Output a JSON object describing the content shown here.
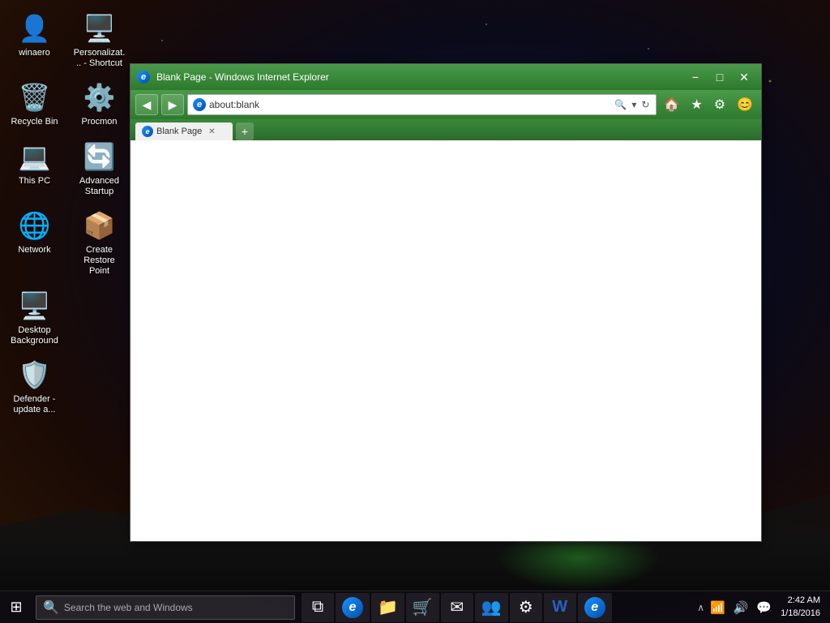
{
  "desktop": {
    "icons": [
      {
        "id": "winaero",
        "label": "winaero",
        "emoji": "👤",
        "color": "#f0c060"
      },
      {
        "id": "personalize-shortcut",
        "label": "Personalizat... - Shortcut",
        "emoji": "🖥️",
        "color": "#4488cc"
      },
      {
        "id": "recycle-bin",
        "label": "Recycle Bin",
        "emoji": "🗑️",
        "color": "#c0c0c0"
      },
      {
        "id": "procmon",
        "label": "Procmon",
        "emoji": "⚙️",
        "color": "#ff8800"
      },
      {
        "id": "this-pc",
        "label": "This PC",
        "emoji": "💻",
        "color": "#4488ee"
      },
      {
        "id": "advanced-startup",
        "label": "Advanced Startup",
        "emoji": "🔄",
        "color": "#00aaff"
      },
      {
        "id": "network",
        "label": "Network",
        "emoji": "🌐",
        "color": "#4488ee"
      },
      {
        "id": "create-restore-point",
        "label": "Create Restore Point",
        "emoji": "📦",
        "color": "#44bb44"
      },
      {
        "id": "desktop-background",
        "label": "Desktop Background",
        "emoji": "🖥️",
        "color": "#4488cc"
      },
      {
        "id": "defender-update",
        "label": "Defender - update a...",
        "emoji": "🛡️",
        "color": "#c0c0c0"
      }
    ]
  },
  "browser": {
    "title": "Blank Page - Windows Internet Explorer",
    "address": "about:blank",
    "tab_title": "Blank Page",
    "tab_icon": "ie",
    "back_btn": "◀",
    "forward_btn": "▶",
    "search_icon": "🔍",
    "refresh_icon": "↻",
    "home_icon": "🏠",
    "favorites_icon": "★",
    "tools_icon": "⚙",
    "emoji_icon": "😊",
    "minimize": "−",
    "maximize": "□",
    "close": "✕"
  },
  "taskbar": {
    "start_icon": "⊞",
    "search_placeholder": "Search the web and Windows",
    "task_view_icon": "⧉",
    "edge_icon": "e",
    "folder_icon": "📁",
    "store_icon": "🛒",
    "mail_icon": "✉",
    "teams_icon": "👥",
    "settings_icon": "⚙",
    "word_icon": "W",
    "ie_icon": "e",
    "tray": {
      "chevron": "∧",
      "network_icon": "📶",
      "volume_icon": "🔊",
      "comment_icon": "💬"
    },
    "clock": {
      "time": "2:42 AM",
      "date": "1/18/2016"
    }
  }
}
